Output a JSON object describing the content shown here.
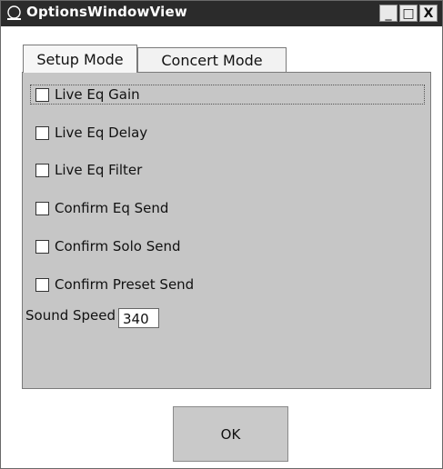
{
  "window": {
    "title": "OptionsWindowView",
    "minimize_symbol": "_",
    "maximize_symbol": "□",
    "close_symbol": "X"
  },
  "tabs": [
    {
      "label": "Setup Mode",
      "active": true
    },
    {
      "label": "Concert Mode",
      "active": false
    }
  ],
  "options": [
    {
      "label": "Live Eq Gain",
      "checked": false,
      "focused": true
    },
    {
      "label": "Live Eq Delay",
      "checked": false
    },
    {
      "label": "Live Eq Filter",
      "checked": false
    },
    {
      "label": "Confirm Eq Send",
      "checked": false
    },
    {
      "label": "Confirm Solo Send",
      "checked": false
    },
    {
      "label": "Confirm Preset Send",
      "checked": false
    }
  ],
  "sound_speed": {
    "label": "Sound Speed",
    "value": "340"
  },
  "ok_label": "OK",
  "colors": {
    "titlebar": "#2b2b2b",
    "panel": "#c6c6c6",
    "button": "#c9c9c9"
  }
}
